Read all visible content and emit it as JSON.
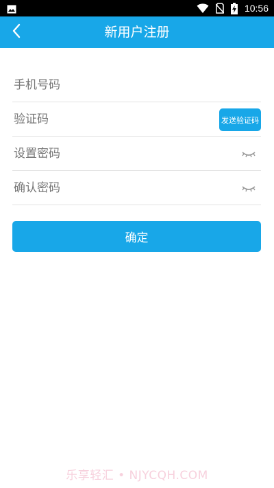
{
  "status_bar": {
    "time": "10:56",
    "icons": [
      "image-icon",
      "wifi-icon",
      "no-sim-icon",
      "battery-charging-icon"
    ]
  },
  "header": {
    "title": "新用户注册",
    "back_icon": "chevron-left-icon"
  },
  "form": {
    "phone_placeholder": "手机号码",
    "code_placeholder": "验证码",
    "send_code_label": "发送验证码",
    "password_placeholder": "设置密码",
    "confirm_password_placeholder": "确认密码",
    "eye_icon": "eye-closed-icon"
  },
  "actions": {
    "confirm_label": "确定"
  },
  "watermark": "乐享轻汇 • NJYCQH.COM",
  "colors": {
    "primary": "#18a7e8",
    "status_bar": "#000000",
    "divider": "#e3e3e3",
    "placeholder": "#777777"
  }
}
